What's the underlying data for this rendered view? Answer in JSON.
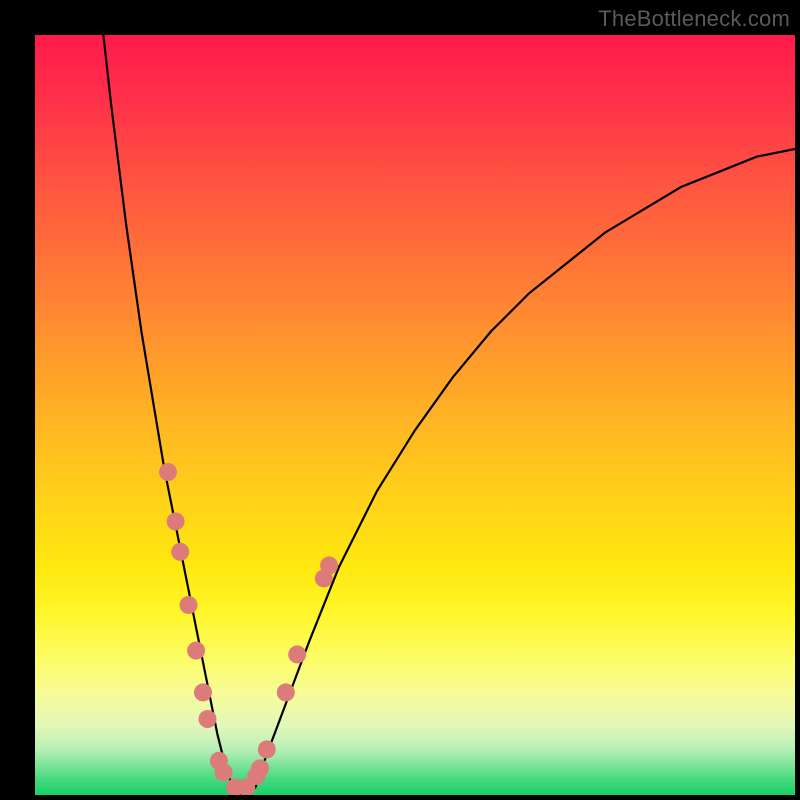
{
  "watermark": "TheBottleneck.com",
  "chart_data": {
    "type": "line",
    "title": "",
    "xlabel": "",
    "ylabel": "",
    "xlim": [
      0,
      100
    ],
    "ylim": [
      0,
      100
    ],
    "series": [
      {
        "name": "curve",
        "x": [
          9,
          10,
          11,
          12,
          13,
          14,
          15,
          16,
          17,
          18,
          19,
          20,
          21,
          22,
          23,
          24,
          25,
          26,
          27,
          28,
          29,
          30,
          33,
          36,
          40,
          45,
          50,
          55,
          60,
          65,
          70,
          75,
          80,
          85,
          90,
          95,
          100
        ],
        "values": [
          100,
          91,
          83,
          75,
          68,
          61,
          55,
          49,
          43,
          38,
          33,
          28,
          23,
          18,
          13,
          8,
          4,
          1,
          0,
          0,
          1,
          4,
          12,
          20,
          30,
          40,
          48,
          55,
          61,
          66,
          70,
          74,
          77,
          80,
          82,
          84,
          85
        ]
      }
    ],
    "markers": {
      "name": "pink-dots",
      "color": "#dd7b7b",
      "points_xy": [
        [
          17.5,
          42.5
        ],
        [
          18.5,
          36
        ],
        [
          19.1,
          32
        ],
        [
          20.2,
          25
        ],
        [
          21.2,
          19
        ],
        [
          22.1,
          13.5
        ],
        [
          22.7,
          10
        ],
        [
          24.2,
          4.5
        ],
        [
          24.8,
          3
        ],
        [
          26.3,
          1
        ],
        [
          27.8,
          1
        ],
        [
          29.1,
          2.5
        ],
        [
          29.6,
          3.5
        ],
        [
          30.5,
          6
        ],
        [
          33.0,
          13.5
        ],
        [
          34.5,
          18.5
        ],
        [
          38.0,
          28.5
        ],
        [
          38.7,
          30.2
        ]
      ]
    },
    "gradient_stops": [
      {
        "pos": 0,
        "color": "#ff1a4b"
      },
      {
        "pos": 8,
        "color": "#ff2f4a"
      },
      {
        "pos": 20,
        "color": "#ff5640"
      },
      {
        "pos": 32,
        "color": "#ff7a36"
      },
      {
        "pos": 42,
        "color": "#ff9a2c"
      },
      {
        "pos": 52,
        "color": "#ffb822"
      },
      {
        "pos": 62,
        "color": "#ffd418"
      },
      {
        "pos": 70,
        "color": "#ffe80f"
      },
      {
        "pos": 76,
        "color": "#fff62a"
      },
      {
        "pos": 82,
        "color": "#fdfd66"
      },
      {
        "pos": 87,
        "color": "#f5fb9a"
      },
      {
        "pos": 91,
        "color": "#e2f7b9"
      },
      {
        "pos": 94,
        "color": "#b7efb7"
      },
      {
        "pos": 96,
        "color": "#7fe49a"
      },
      {
        "pos": 98,
        "color": "#44d97e"
      },
      {
        "pos": 100,
        "color": "#18cf65"
      }
    ]
  }
}
